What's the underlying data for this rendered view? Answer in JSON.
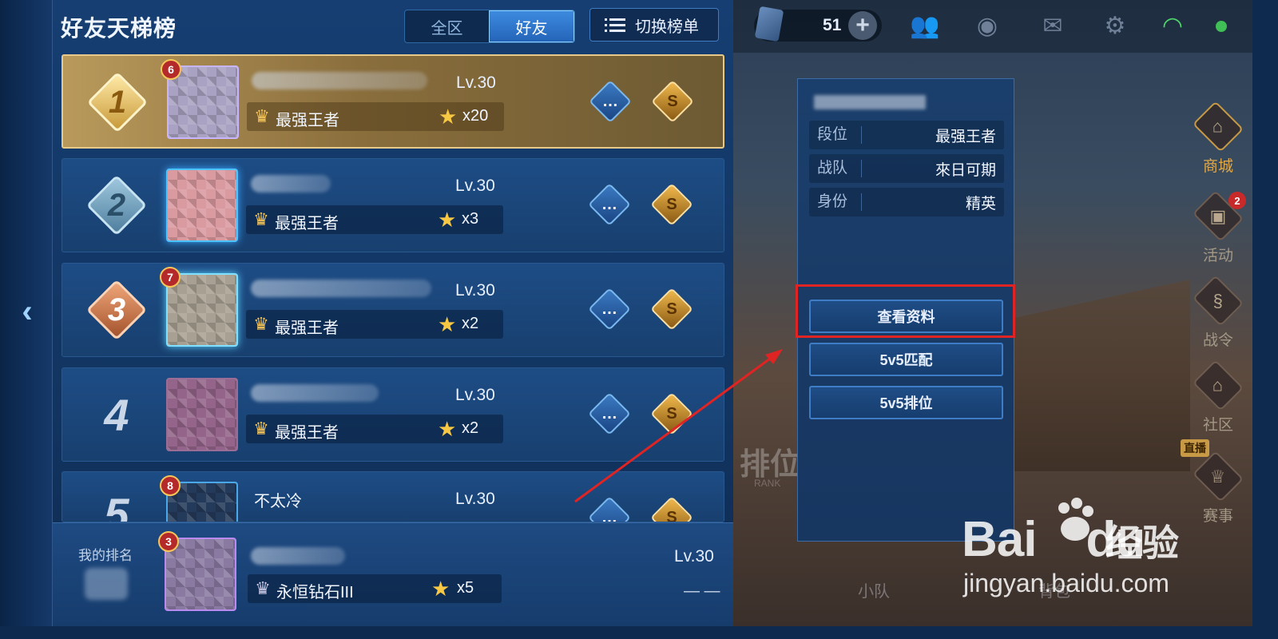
{
  "panel": {
    "title": "好友天梯榜",
    "tabs": [
      {
        "label": "全区",
        "active": false
      },
      {
        "label": "好友",
        "active": true
      }
    ],
    "switch_label": "切换榜单",
    "rows": [
      {
        "rank": "1",
        "level_tag": "6",
        "name": "",
        "lv": "Lv.30",
        "tier": "最强王者",
        "stars": "x20"
      },
      {
        "rank": "2",
        "level_tag": "",
        "name": "",
        "lv": "Lv.30",
        "tier": "最强王者",
        "stars": "x3"
      },
      {
        "rank": "3",
        "level_tag": "7",
        "name": "",
        "lv": "Lv.30",
        "tier": "最强王者",
        "stars": "x2"
      },
      {
        "rank": "4",
        "level_tag": "",
        "name": "",
        "lv": "Lv.30",
        "tier": "最强王者",
        "stars": "x2"
      },
      {
        "rank": "5",
        "level_tag": "8",
        "name": "不太冷",
        "lv": "Lv.30",
        "tier": "",
        "stars": ""
      }
    ],
    "my_rank": {
      "label": "我的排名",
      "level_tag": "3",
      "lv": "Lv.30",
      "tier": "永恒钻石III",
      "stars": "x5",
      "dash": "— —"
    }
  },
  "top_bar": {
    "currency_value": "51",
    "currency_plus": "+"
  },
  "popup": {
    "info": [
      {
        "key": "段位",
        "value": "最强王者"
      },
      {
        "key": "战队",
        "value": "來日可期"
      },
      {
        "key": "身份",
        "value": "精英"
      }
    ],
    "buttons": [
      "查看资料",
      "5v5匹配",
      "5v5排位"
    ]
  },
  "side_menu": [
    {
      "label": "商城",
      "badge": ""
    },
    {
      "label": "活动",
      "badge": "2"
    },
    {
      "label": "战令",
      "badge": ""
    },
    {
      "label": "社区",
      "badge": ""
    },
    {
      "label": "赛事",
      "badge": ""
    }
  ],
  "live_tag": "直播",
  "background": {
    "rank_text": "排位",
    "rank_sub": "RANK",
    "bottom_items": [
      "小队",
      "背包"
    ]
  },
  "watermark": {
    "logo_left": "Bai",
    "logo_right": "du",
    "text": "经验",
    "url": "jingyan.baidu.com"
  },
  "colors": {
    "panel_bg": "#163e72",
    "gold_row": "#b99a5c",
    "highlight": "#e02424",
    "star": "#f7c843"
  }
}
